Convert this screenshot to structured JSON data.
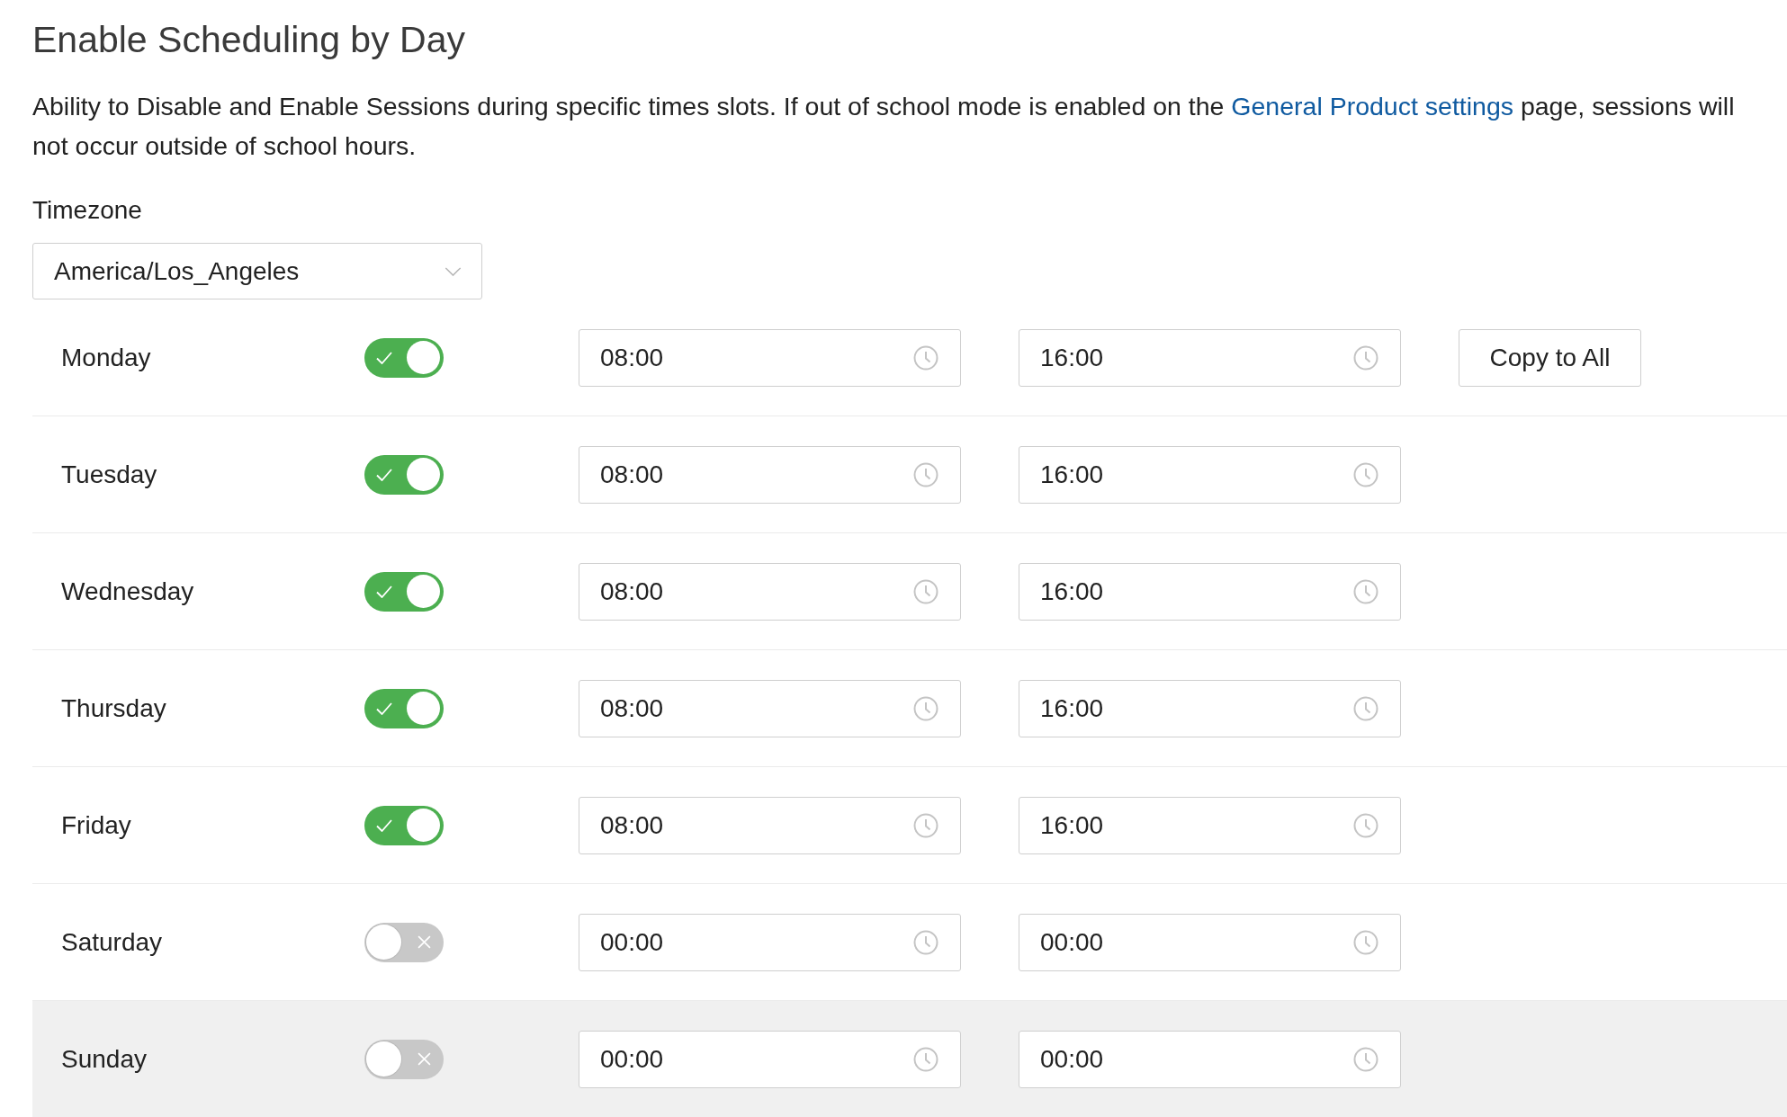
{
  "title": "Enable Scheduling by Day",
  "description": {
    "text_before": "Ability to Disable and Enable Sessions during specific times slots. If out of school mode is enabled on the",
    "link": "General Product settings",
    "text_after": "page, sessions will not occur outside of school hours."
  },
  "timezone": {
    "label": "Timezone",
    "value": "America/Los_Angeles"
  },
  "days": [
    {
      "name": "Monday",
      "enabled": true,
      "start": "08:00",
      "end": "16:00",
      "highlighted": false,
      "action": "Copy to All"
    },
    {
      "name": "Tuesday",
      "enabled": true,
      "start": "08:00",
      "end": "16:00",
      "highlighted": false
    },
    {
      "name": "Wednesday",
      "enabled": true,
      "start": "08:00",
      "end": "16:00",
      "highlighted": false
    },
    {
      "name": "Thursday",
      "enabled": true,
      "start": "08:00",
      "end": "16:00",
      "highlighted": false
    },
    {
      "name": "Friday",
      "enabled": true,
      "start": "08:00",
      "end": "16:00",
      "highlighted": false
    },
    {
      "name": "Saturday",
      "enabled": false,
      "start": "00:00",
      "end": "00:00",
      "highlighted": false
    },
    {
      "name": "Sunday",
      "enabled": false,
      "start": "00:00",
      "end": "00:00",
      "highlighted": true
    }
  ]
}
